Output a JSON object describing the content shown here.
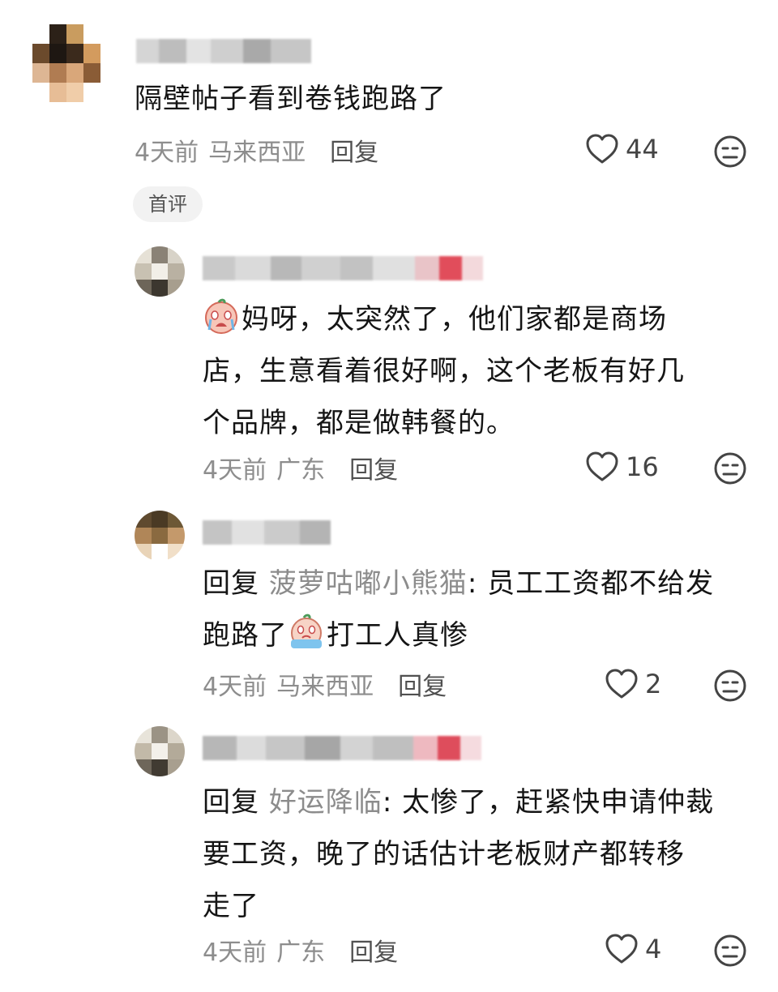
{
  "comments": [
    {
      "text": "隔壁帖子看到卷钱跑路了",
      "time": "4天前",
      "location": "马来西亚",
      "reply_label": "回复",
      "likes": "44"
    },
    {
      "tag": "首评",
      "lines": [
        "妈呀，太突然了，他们家都是商场",
        "店，生意看着很好啊，这个老板有好几",
        "个品牌，都是做韩餐的。"
      ],
      "emoji_name": "crying-face-emoji",
      "time": "4天前",
      "location": "广东",
      "reply_label": "回复",
      "likes": "16"
    },
    {
      "reply_prefix": "回复",
      "reply_to": "菠萝咕嘟小熊猫",
      "line1_rest": ": 员工工资都不给发",
      "line2_a": "跑路了",
      "line2_b": "打工人真惨",
      "emoji_name": "crying-face-emoji",
      "time": "4天前",
      "location": "马来西亚",
      "reply_label": "回复",
      "likes": "2"
    },
    {
      "reply_prefix": "回复",
      "reply_to": "好运降临",
      "line1_rest": ": 太惨了，赶紧快申请仲裁",
      "line2": "要工资，晚了的话估计老板财产都转移",
      "line3": "走了",
      "time": "4天前",
      "location": "广东",
      "reply_label": "回复",
      "likes": "4"
    }
  ],
  "icons": {
    "like": "heart-outline-icon",
    "dislike": "neutral-face-icon"
  },
  "colors": {
    "primary_text": "#151515",
    "meta_text": "#8d8d8d",
    "reply_target": "#8c8c8c",
    "tag_bg": "#f2f2f2"
  }
}
